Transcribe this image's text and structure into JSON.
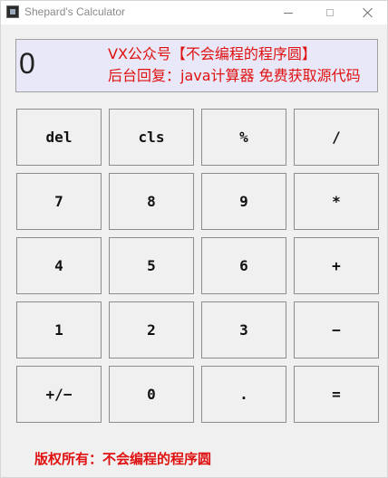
{
  "window": {
    "title": "Shepard's Calculator"
  },
  "display": {
    "value": "0",
    "notice_line1": "VX公众号【不会编程的程序圆】",
    "notice_line2": "后台回复：java计算器 免费获取源代码"
  },
  "keypad": {
    "rows": [
      [
        "del",
        "cls",
        "%",
        "/"
      ],
      [
        "7",
        "8",
        "9",
        "*"
      ],
      [
        "4",
        "5",
        "6",
        "+"
      ],
      [
        "1",
        "2",
        "3",
        "−"
      ],
      [
        "+/−",
        "0",
        ".",
        "="
      ]
    ]
  },
  "footer": {
    "copyright": "版权所有：不会编程的程序圆"
  },
  "colors": {
    "notice_text": "#e01010",
    "display_bg": "#e8e8f8",
    "window_bg": "#f0f0f0"
  },
  "icons": {
    "app": "app-icon",
    "minimize": "minimize-icon",
    "maximize": "maximize-icon",
    "close": "close-icon"
  }
}
